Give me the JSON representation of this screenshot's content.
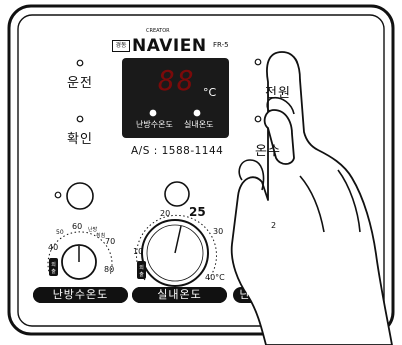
{
  "brand": {
    "maker_tag": "경동",
    "creator": "CREATOR",
    "name": "NAVIEN",
    "model": "FR-5"
  },
  "left_buttons": {
    "power_label": "운전",
    "check_label": "확인"
  },
  "display": {
    "digits": "88",
    "unit": "°C",
    "mode_water": "난방수온도",
    "mode_room": "실내온도"
  },
  "service": {
    "as_text": "A/S : 1588-1144"
  },
  "right_buttons": {
    "power_label": "전원",
    "hot_water_label": "온수"
  },
  "dials": {
    "water": {
      "ticks": [
        "60",
        "70",
        "40",
        "80"
      ],
      "sub_ticks": [
        "50",
        "난방",
        "취침"
      ],
      "label": "난방수온도",
      "badge": "외출"
    },
    "room": {
      "ticks": [
        "20",
        "25",
        "30",
        "10",
        "40°C"
      ],
      "label": "실내온도",
      "badge": "외출"
    },
    "third": {
      "tick": "2",
      "label": "난"
    }
  }
}
